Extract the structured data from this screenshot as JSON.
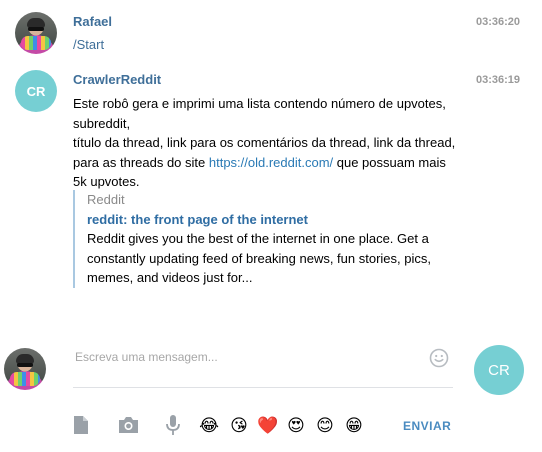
{
  "messages": [
    {
      "sender": "Rafael",
      "time": "03:36:20",
      "text": "/Start"
    },
    {
      "sender": "CrawlerReddit",
      "avatar_initials": "CR",
      "time": "03:36:19",
      "text_before_link": "Este robô gera e imprimi uma lista contendo número de upvotes,\nsubreddit,\ntítulo da thread, link para os comentários da thread, link da thread,\npara as threads do site ",
      "link": "https://old.reddit.com/",
      "text_after_link": " que possuam mais\n5k upvotes.",
      "preview": {
        "site": "Reddit",
        "title": "reddit: the front page of the internet",
        "description": "Reddit gives you the best of the internet in one place. Get a constantly updating feed of breaking news, fun stories, pics, memes, and videos just for..."
      }
    }
  ],
  "composer": {
    "placeholder": "Escreva uma mensagem...",
    "right_avatar_initials": "CR",
    "send_label": "ENVIAR",
    "emojis": [
      "😂",
      "😘",
      "❤️",
      "😍",
      "😊",
      "😁"
    ]
  },
  "colors": {
    "sender": "#3f6f99",
    "link": "#2a7ab5",
    "avatar_bg": "#76cfd3",
    "send": "#4a8bc0"
  }
}
